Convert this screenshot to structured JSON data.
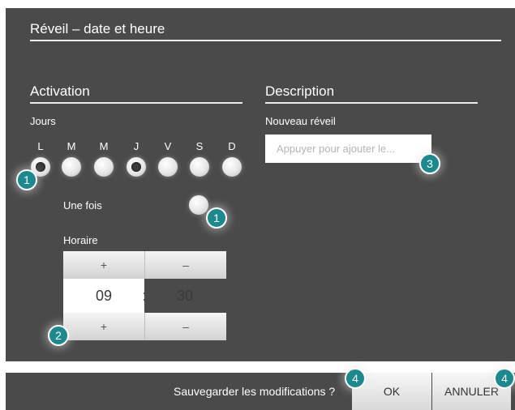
{
  "header": {
    "title": "Réveil – date et heure"
  },
  "activation": {
    "title": "Activation",
    "days_label": "Jours",
    "days": [
      {
        "letter": "L",
        "selected": true
      },
      {
        "letter": "M",
        "selected": false
      },
      {
        "letter": "M",
        "selected": false
      },
      {
        "letter": "J",
        "selected": true
      },
      {
        "letter": "V",
        "selected": false
      },
      {
        "letter": "S",
        "selected": false
      },
      {
        "letter": "D",
        "selected": false
      }
    ],
    "once_label": "Une fois",
    "schedule_label": "Horaire",
    "time": {
      "plus_label": "+",
      "minus_label": "–",
      "hours": "09",
      "separator": ":",
      "minutes": "30"
    }
  },
  "description": {
    "title": "Description",
    "field_label": "Nouveau réveil",
    "input_placeholder": "Appuyer pour ajouter le..."
  },
  "footer": {
    "question": "Sauvegarder les modifications ?",
    "ok_label": "OK",
    "cancel_label": "ANNULER"
  },
  "callouts": {
    "days": "1",
    "once": "1",
    "time": "2",
    "description": "3",
    "ok": "4",
    "cancel": "4"
  },
  "colors": {
    "panel": "#4a4a4a",
    "badge": "#1a8a8e"
  }
}
